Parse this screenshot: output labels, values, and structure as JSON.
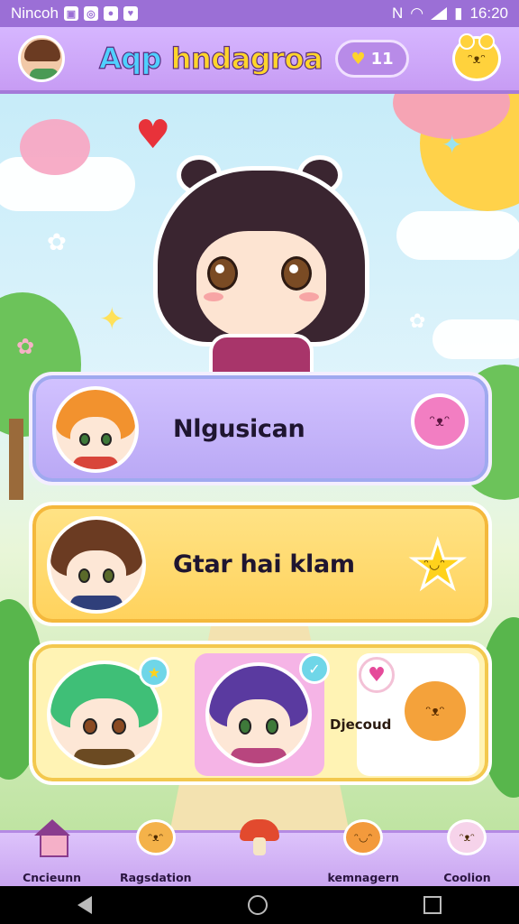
{
  "status_bar": {
    "carrier": "Nincoh",
    "time": "16:20",
    "icons": [
      "sim-icon",
      "settings-icon",
      "person-icon",
      "heart-icon",
      "nfc-icon",
      "wifi-icon",
      "signal-icon",
      "battery-icon"
    ]
  },
  "header": {
    "title_part1": "Aqp",
    "title_part2": " hndagroa",
    "coin_count": "11",
    "coin_icon": "heart-icon"
  },
  "cards": [
    {
      "label": "Nlgusican"
    },
    {
      "label": "Gtar hai klam"
    },
    {
      "label": "Djecoud"
    }
  ],
  "bottom_nav": {
    "items": [
      {
        "label": "Cncieunn",
        "icon": "house-icon"
      },
      {
        "label": "Ragsdation",
        "icon": "dog-icon"
      },
      {
        "label": "",
        "icon": "mushroom-icon"
      },
      {
        "label": "kemnagern",
        "icon": "orange-blob-icon"
      },
      {
        "label": "Coolion",
        "icon": "bunny-icon"
      }
    ]
  },
  "colors": {
    "status_bar": "#9b6fd6",
    "header": "#c79cf4",
    "card_purple": "#b9a8f5",
    "card_yellow": "#ffd25c",
    "card_cream": "#fff3b4",
    "title_yellow": "#ffd52b",
    "title_blue": "#4fd0ff"
  }
}
